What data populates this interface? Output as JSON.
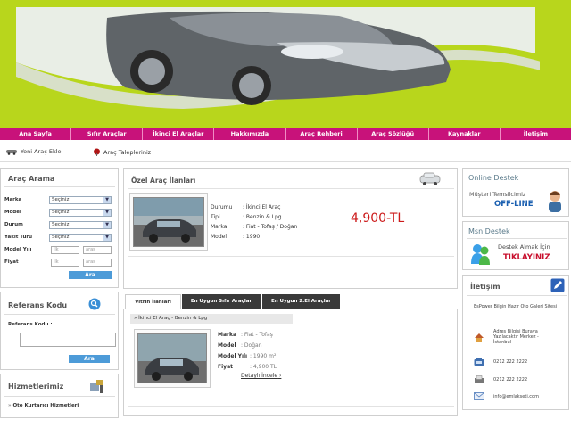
{
  "nav": {
    "items": [
      "Ana Sayfa",
      "Sıfır Araçlar",
      "İkinci El Araçlar",
      "Hakkımızda",
      "Araç Rehberi",
      "Araç Sözlüğü",
      "Kaynaklar",
      "İletişim"
    ]
  },
  "toolbar": {
    "add_car": "Yeni Araç Ekle",
    "car_request": "Araç Talepleriniz"
  },
  "search": {
    "title": "Araç Arama",
    "fields": [
      {
        "label": "Marka",
        "value": "Seçiniz"
      },
      {
        "label": "Model",
        "value": "Seçiniz"
      },
      {
        "label": "Durum",
        "value": "Seçiniz"
      },
      {
        "label": "Yakıt Türü",
        "value": "Seçiniz"
      }
    ],
    "year_label": "Model Yılı",
    "price_label": "Fiyat",
    "from_placeholder": "ilk",
    "to_placeholder": "aras",
    "button": "Ara"
  },
  "reference": {
    "title": "Referans Kodu",
    "label": "Referans Kodu :",
    "button": "Ara"
  },
  "services": {
    "title": "Hizmetlerimiz",
    "first_item": "Oto Kurtarıcı Hizmetleri"
  },
  "special": {
    "title": "Özel Araç İlanları",
    "rows": [
      {
        "label": "Durumu",
        "value": ": İkinci El Araç"
      },
      {
        "label": "Tipi",
        "value": ": Benzin & Lpg"
      },
      {
        "label": "Marka",
        "value": ": Fiat - Tofaş / Doğan"
      },
      {
        "label": "Model",
        "value": ": 1990"
      }
    ],
    "price": "4,900-TL"
  },
  "tabs": [
    "Vitrin İlanları",
    "En Uygun Sıfır Araçlar",
    "En Uygun 2.El Araçlar"
  ],
  "listing": {
    "header": "İkinci El Araç - Benzin & Lpg",
    "rows": [
      {
        "label": "Marka",
        "value": ": Fiat - Tofaş"
      },
      {
        "label": "Model",
        "value": ": Doğan"
      },
      {
        "label": "Model Yılı",
        "value": ": 1990 m²"
      },
      {
        "label": "Fiyat",
        "value": ": 4,900 TL"
      }
    ],
    "detail_link": "Detaylı İncele"
  },
  "online": {
    "title": "Online Destek",
    "line1": "Müşteri Temsilcimiz",
    "line2": "OFF-LINE"
  },
  "msn": {
    "title": "Msn Destek",
    "line1": "Destek Almak İçin",
    "line2": "TIKLAYINIZ"
  },
  "contact": {
    "title": "İletişim",
    "company": "EsPower Bilgin Hazır Oto Galeri Sitesi",
    "address": "Adres Bilgisi Buraya Yazılacaktır Merkez - İstanbul",
    "phone": "0212 222 2222",
    "fax": "0212 222 2222",
    "email": "info@emlakseti.com"
  },
  "colors": {
    "header_green": "#b8d61c",
    "nav_magenta": "#c8127a",
    "price_red": "#cc1a1a",
    "button_blue": "#4d9bd8"
  }
}
